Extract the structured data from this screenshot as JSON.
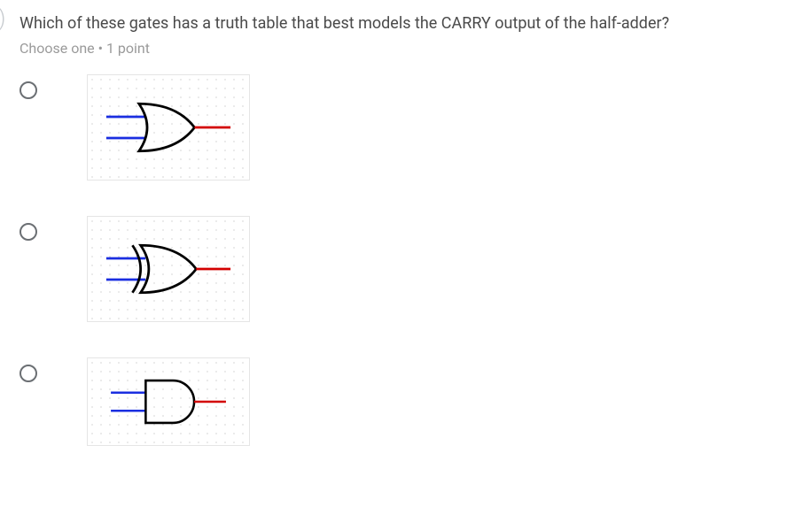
{
  "question": {
    "text": "Which of these gates has a truth table that best models the CARRY output of the half-adder?",
    "instruction": "Choose one • 1 point"
  },
  "options": [
    {
      "gate": "OR"
    },
    {
      "gate": "XOR"
    },
    {
      "gate": "AND"
    }
  ]
}
